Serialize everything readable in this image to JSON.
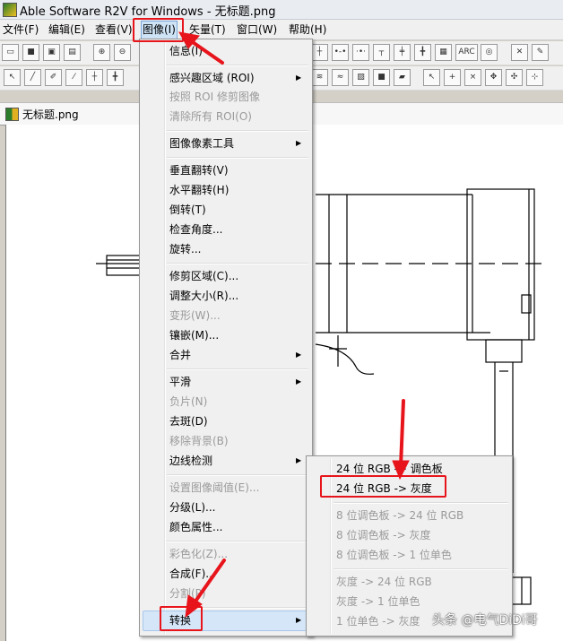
{
  "window": {
    "title": "Able Software R2V for Windows - 无标题.png"
  },
  "menubar": [
    {
      "label": "文件(F)"
    },
    {
      "label": "编辑(E)"
    },
    {
      "label": "查看(V)"
    },
    {
      "label": "图像(I)"
    },
    {
      "label": "矢量(T)"
    },
    {
      "label": "窗口(W)"
    },
    {
      "label": "帮助(H)"
    }
  ],
  "document_tab": {
    "title": "无标题.png"
  },
  "image_menu": {
    "items": [
      {
        "label": "信息(I)",
        "enabled": true
      },
      {
        "label": "感兴趣区域 (ROI)",
        "enabled": true,
        "submenu": true
      },
      {
        "label": "按照 ROI 修剪图像",
        "enabled": false
      },
      {
        "label": "清除所有 ROI(O)",
        "enabled": false
      },
      {
        "label": "图像像素工具",
        "enabled": true,
        "submenu": true
      },
      {
        "label": "垂直翻转(V)",
        "enabled": true
      },
      {
        "label": "水平翻转(H)",
        "enabled": true
      },
      {
        "label": "倒转(T)",
        "enabled": true
      },
      {
        "label": "检查角度...",
        "enabled": true
      },
      {
        "label": "旋转...",
        "enabled": true
      },
      {
        "label": "修剪区域(C)...",
        "enabled": true
      },
      {
        "label": "调整大小(R)...",
        "enabled": true
      },
      {
        "label": "变形(W)...",
        "enabled": false
      },
      {
        "label": "镶嵌(M)...",
        "enabled": true
      },
      {
        "label": "合并",
        "enabled": true,
        "submenu": true
      },
      {
        "label": "平滑",
        "enabled": true,
        "submenu": true
      },
      {
        "label": "负片(N)",
        "enabled": false
      },
      {
        "label": "去斑(D)",
        "enabled": true
      },
      {
        "label": "移除背景(B)",
        "enabled": false
      },
      {
        "label": "边线检测",
        "enabled": true,
        "submenu": true
      },
      {
        "label": "设置图像阈值(E)...",
        "enabled": false
      },
      {
        "label": "分级(L)...",
        "enabled": true
      },
      {
        "label": "颜色属性...",
        "enabled": true
      },
      {
        "label": "彩色化(Z)...",
        "enabled": false
      },
      {
        "label": "合成(F)...",
        "enabled": true
      },
      {
        "label": "分割(P)",
        "enabled": false
      },
      {
        "label": "转换",
        "enabled": true,
        "submenu": true,
        "highlighted": true
      }
    ]
  },
  "convert_submenu": {
    "items": [
      {
        "label": "24 位 RGB -> 调色板",
        "enabled": true
      },
      {
        "label": "24 位 RGB -> 灰度",
        "enabled": true
      },
      {
        "label": "8 位调色板 -> 24 位 RGB",
        "enabled": false
      },
      {
        "label": "8 位调色板 -> 灰度",
        "enabled": false
      },
      {
        "label": "8 位调色板 -> 1 位单色",
        "enabled": false
      },
      {
        "label": "灰度 -> 24 位 RGB",
        "enabled": false
      },
      {
        "label": "灰度 -> 1 位单色",
        "enabled": false
      },
      {
        "label": "1 位单色 -> 灰度",
        "enabled": false
      }
    ]
  },
  "annotation_color": "#e8141b",
  "watermark": "头条 @电气DiDi哥"
}
